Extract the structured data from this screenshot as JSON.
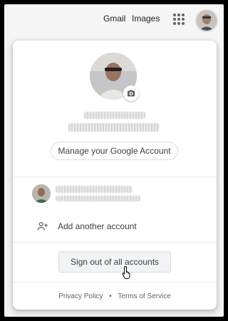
{
  "topbar": {
    "gmail_label": "Gmail",
    "images_label": "Images",
    "apps_icon": "apps-grid-icon",
    "avatar_icon": "profile-avatar"
  },
  "card": {
    "camera_icon": "camera-icon",
    "manage_account_label": "Manage your Google Account",
    "add_account_label": "Add another account",
    "add_account_icon": "person-add-icon",
    "signout_label": "Sign out of all accounts",
    "footer": {
      "privacy_label": "Privacy Policy",
      "separator": "•",
      "terms_label": "Terms of Service"
    }
  },
  "colors": {
    "link_text": "#202124",
    "secondary_text": "#5f6368",
    "divider": "#e8eaed",
    "button_border": "#dadce0"
  }
}
